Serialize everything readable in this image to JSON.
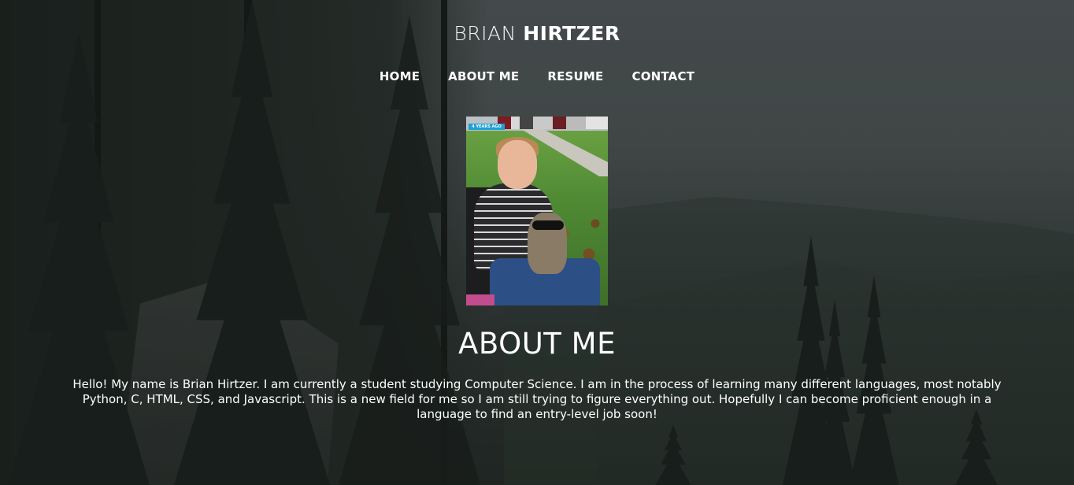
{
  "header": {
    "brand_first": "BRIAN",
    "brand_last": "HIRTZER"
  },
  "nav": {
    "items": [
      {
        "label": "HOME"
      },
      {
        "label": "ABOUT ME"
      },
      {
        "label": "RESUME"
      },
      {
        "label": "CONTACT"
      }
    ]
  },
  "profile": {
    "photo_badge": "4 YEARS AGO"
  },
  "about": {
    "title": "ABOUT ME",
    "body": "Hello! My name is Brian Hirtzer. I am currently a student studying Computer Science. I am in the process of learning many different languages, most notably Python, C, HTML, CSS, and Javascript. This is a new field for me so I am still trying to figure everything out. Hopefully I can become proficient enough in a language to find an entry-level job soon!"
  },
  "colors": {
    "text": "#ffffff",
    "badge": "#1ea0d6"
  }
}
